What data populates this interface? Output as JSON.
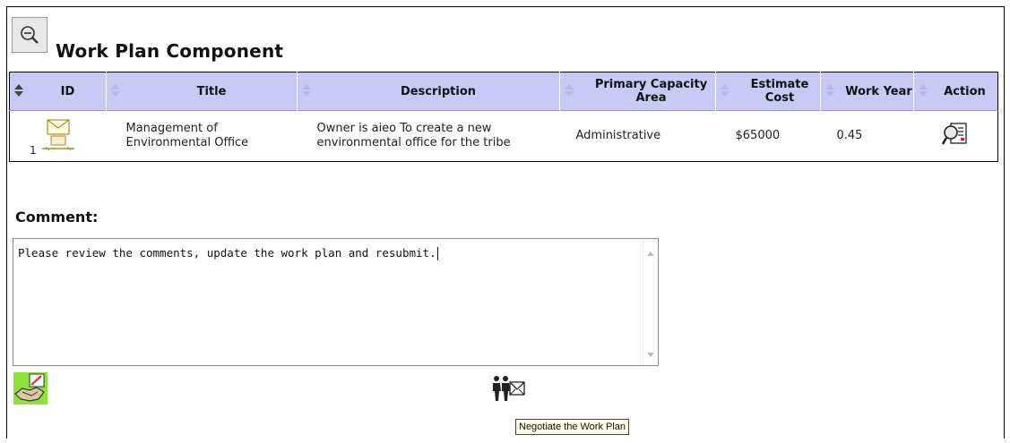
{
  "page": {
    "title": "Work Plan Component",
    "zoom_icon": "zoom-out-icon"
  },
  "table": {
    "columns": [
      {
        "key": "id",
        "label": "ID"
      },
      {
        "key": "title",
        "label": "Title"
      },
      {
        "key": "description",
        "label": "Description"
      },
      {
        "key": "area",
        "label": "Primary Capacity Area"
      },
      {
        "key": "cost",
        "label": "Estimate Cost"
      },
      {
        "key": "year",
        "label": "Work Year"
      },
      {
        "key": "action",
        "label": "Action"
      }
    ],
    "rows": [
      {
        "id": "1",
        "id_icon": "mail-document-icon",
        "title": "Management of Environmental Office",
        "description": "Owner is aieo To create a new environmental office for the tribe",
        "area": "Administrative",
        "cost": "$65000",
        "year": "0.45",
        "action_icon": "view-details-icon"
      }
    ]
  },
  "comment": {
    "label": "Comment:",
    "value": "Please review the comments, update the work plan and resubmit."
  },
  "footer": {
    "approve_icon": "handshake-approve-icon",
    "negotiate_icon": "negotiate-icon",
    "tooltip": "Negotiate the Work Plan"
  }
}
